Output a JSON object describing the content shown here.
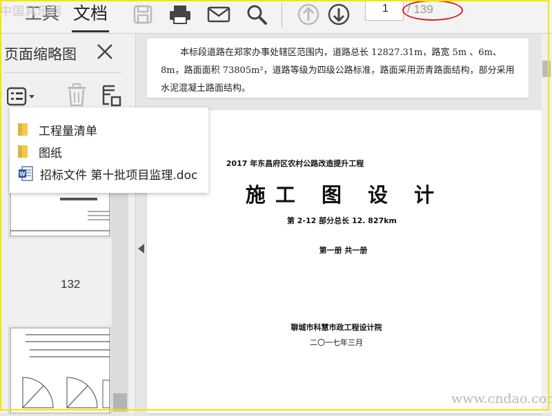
{
  "watermark": {
    "top": "中国具乐网",
    "bottom": "www.cndao.com"
  },
  "toolbar": {
    "tab_tools": "工具",
    "tab_document": "文档",
    "icons": [
      "save-icon",
      "print-icon",
      "email-icon",
      "search-icon",
      "page-up-icon",
      "page-down-icon"
    ],
    "page_current": "1",
    "page_total": "/ 139"
  },
  "sidebar": {
    "title": "页面缩略图",
    "thumb_label": "132"
  },
  "popup": {
    "items": [
      {
        "label": "工程量清单",
        "icon": "folder-icon"
      },
      {
        "label": "图纸",
        "icon": "folder-icon"
      },
      {
        "label": "招标文件  第十批项目监理.doc",
        "icon": "word-doc-icon"
      }
    ]
  },
  "document": {
    "paragraph": "本标段道路在郑家办事处辖区范围内，道路总长 12827.31m，路宽 5m 、6m、8m，路面面积 73805m²，道路等级为四级公路标准，路面采用沥青路面结构，部分采用水泥混凝土路面结构。",
    "cover": {
      "project": "2017 年东昌府区农村公路改造提升工程",
      "title": "施工 图 设 计",
      "section": "第 2-12 部分总长 12. 827km",
      "volume": "第一册  共一册",
      "institute": "聊城市科慧市政工程设计院",
      "date": "二〇一七年三月"
    }
  },
  "colors": {
    "highlight_ring": "#d51f1f",
    "frame": "#f2e600",
    "folder": "#f2c94c",
    "word_blue": "#2b579a"
  }
}
